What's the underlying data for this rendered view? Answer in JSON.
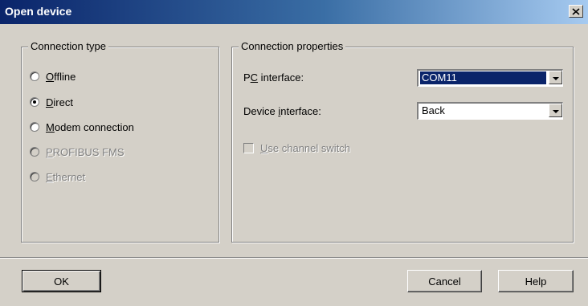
{
  "window": {
    "title": "Open device",
    "close_icon": "close-icon"
  },
  "connection_type": {
    "legend": "Connection type",
    "options": [
      {
        "pre": "",
        "key": "O",
        "post": "ffline",
        "selected": false,
        "enabled": true
      },
      {
        "pre": "",
        "key": "D",
        "post": "irect",
        "selected": true,
        "enabled": true
      },
      {
        "pre": "",
        "key": "M",
        "post": "odem connection",
        "selected": false,
        "enabled": true
      },
      {
        "pre": "",
        "key": "P",
        "post": "ROFIBUS FMS",
        "selected": false,
        "enabled": false
      },
      {
        "pre": "",
        "key": "E",
        "post": "thernet",
        "selected": false,
        "enabled": false
      }
    ]
  },
  "connection_properties": {
    "legend": "Connection properties",
    "pc_interface": {
      "pre": "P",
      "key": "C",
      "post": " interface:",
      "value": "COM11"
    },
    "device_interface": {
      "pre": "Device ",
      "key": "i",
      "post": "nterface:",
      "value": "Back"
    },
    "channel_switch": {
      "pre": "",
      "key": "U",
      "post": "se channel switch",
      "checked": false,
      "enabled": false
    }
  },
  "buttons": {
    "ok": "OK",
    "cancel": "Cancel",
    "help": "Help"
  },
  "colors": {
    "title_gradient_start": "#0a246a",
    "title_gradient_end": "#a6caf0",
    "face": "#d4d0c8",
    "selection": "#0a246a"
  }
}
